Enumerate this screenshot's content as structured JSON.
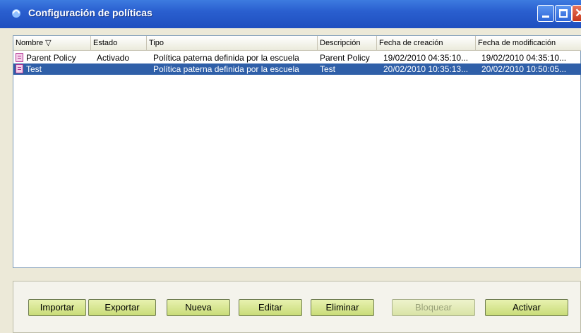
{
  "window": {
    "title": "Configuración de políticas"
  },
  "table": {
    "columns": [
      "Nombre ▽",
      "Estado",
      "Tipo",
      "Descripción",
      "Fecha de creación",
      "Fecha de modificación"
    ],
    "rows": [
      {
        "nombre": "Parent Policy",
        "estado": "Activado",
        "tipo": "Política paterna definida por la escuela",
        "descripcion": "Parent Policy",
        "creacion": "19/02/2010 04:35:10...",
        "modificacion": "19/02/2010 04:35:10...",
        "selected": false
      },
      {
        "nombre": "Test",
        "estado": "",
        "tipo": "Política paterna definida por la escuela",
        "descripcion": "Test",
        "creacion": "20/02/2010 10:35:13...",
        "modificacion": "20/02/2010 10:50:05...",
        "selected": true
      }
    ]
  },
  "buttons": {
    "importar": "Importar",
    "exportar": "Exportar",
    "nueva": "Nueva",
    "editar": "Editar",
    "eliminar": "Eliminar",
    "bloquear": "Bloquear",
    "activar": "Activar"
  },
  "colors": {
    "titlebar": "#2a5fcf",
    "selection": "#2f5fa8",
    "button": "#c9dc78"
  }
}
